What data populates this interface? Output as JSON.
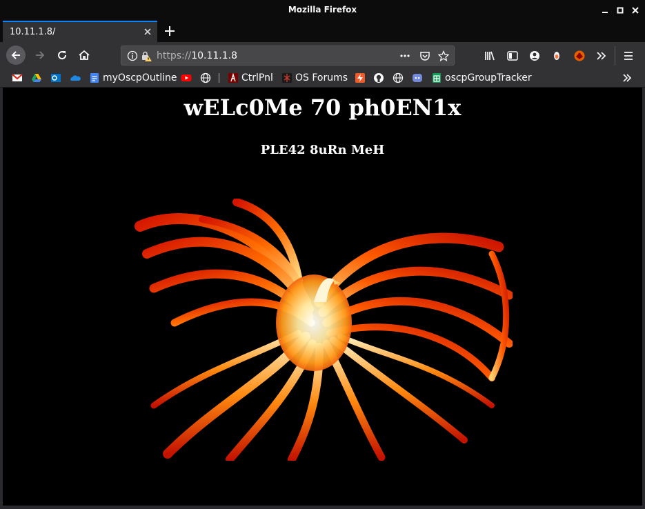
{
  "window": {
    "title": "Mozilla Firefox"
  },
  "tabs": [
    {
      "title": "10.11.1.8/",
      "active": true
    }
  ],
  "urlbar": {
    "scheme": "https://",
    "host": "10.11.1.8"
  },
  "bookmarks": [
    {
      "label": "",
      "icon": "gmail-icon"
    },
    {
      "label": "",
      "icon": "google-drive-icon"
    },
    {
      "label": "",
      "icon": "outlook-icon"
    },
    {
      "label": "",
      "icon": "onedrive-icon"
    },
    {
      "label": "myOscpOutline",
      "icon": "google-docs-icon"
    },
    {
      "label": "",
      "icon": "youtube-icon"
    },
    {
      "label": "",
      "icon": "globe-icon"
    },
    {
      "label": "CtrlPnl",
      "icon": "ctrlpnl-icon"
    },
    {
      "label": "OS Forums",
      "icon": "offsec-icon"
    },
    {
      "label": "",
      "icon": "lightning-icon"
    },
    {
      "label": "",
      "icon": "github-icon"
    },
    {
      "label": "",
      "icon": "globe-icon"
    },
    {
      "label": "",
      "icon": "discord-icon"
    },
    {
      "label": "oscpGroupTracker",
      "icon": "google-sheets-icon"
    }
  ],
  "page": {
    "heading": "wELc0Me 70 ph0EN1x",
    "subheading": "PLE42 8uRn MeH",
    "image": "phoenix-image"
  },
  "colors": {
    "accent": "#0a84ff",
    "chrome": "#323234",
    "page_bg": "#000000"
  }
}
